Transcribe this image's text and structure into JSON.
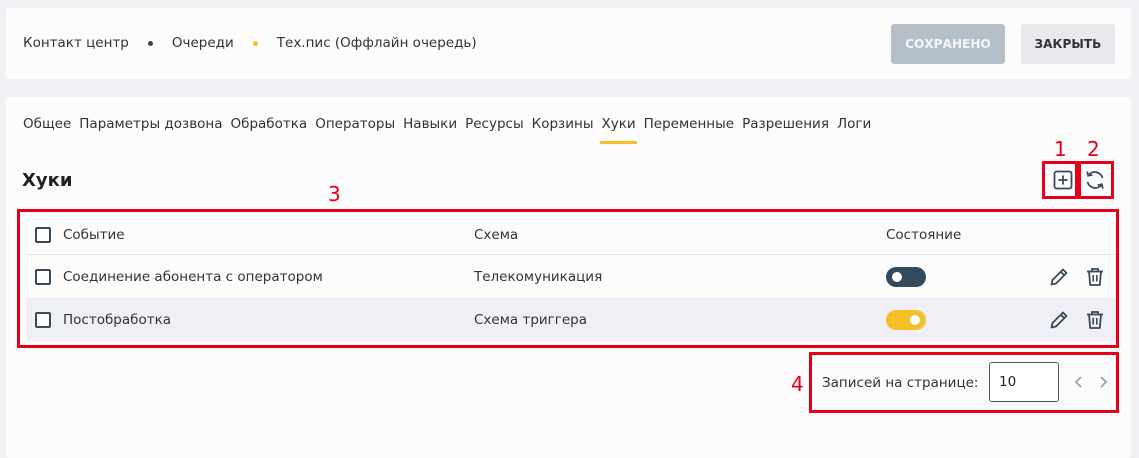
{
  "breadcrumb": {
    "items": [
      "Контакт центр",
      "Очереди",
      "Тех.пис (Оффлайн очередь)"
    ],
    "dot_colors": [
      "#2f4556",
      "#f5bf27"
    ]
  },
  "header": {
    "saved_label": "СОХРАНЕНО",
    "close_label": "ЗАКРЫТЬ"
  },
  "tabs": [
    {
      "label": "Общее"
    },
    {
      "label": "Параметры дозвона"
    },
    {
      "label": "Обработка"
    },
    {
      "label": "Операторы"
    },
    {
      "label": "Навыки"
    },
    {
      "label": "Ресурсы"
    },
    {
      "label": "Корзины"
    },
    {
      "label": "Хуки",
      "active": true
    },
    {
      "label": "Переменные"
    },
    {
      "label": "Разрешения"
    },
    {
      "label": "Логи"
    }
  ],
  "section": {
    "title": "Хуки",
    "add_icon": "add-square-icon",
    "refresh_icon": "refresh-icon"
  },
  "table": {
    "columns": [
      "Событие",
      "Схема",
      "Состояние"
    ],
    "rows": [
      {
        "event": "Соединение абонента с оператором",
        "scheme": "Телекомуникация",
        "enabled": false
      },
      {
        "event": "Постобработка",
        "scheme": "Схема триггера",
        "enabled": true
      }
    ]
  },
  "pagination": {
    "label": "Записей на странице:",
    "per_page": "10"
  },
  "annotations": [
    "1",
    "2",
    "3",
    "4"
  ],
  "colors": {
    "accent": "#f5bf27",
    "toggle_off": "#344b5d",
    "annotation": "#e8001b"
  }
}
